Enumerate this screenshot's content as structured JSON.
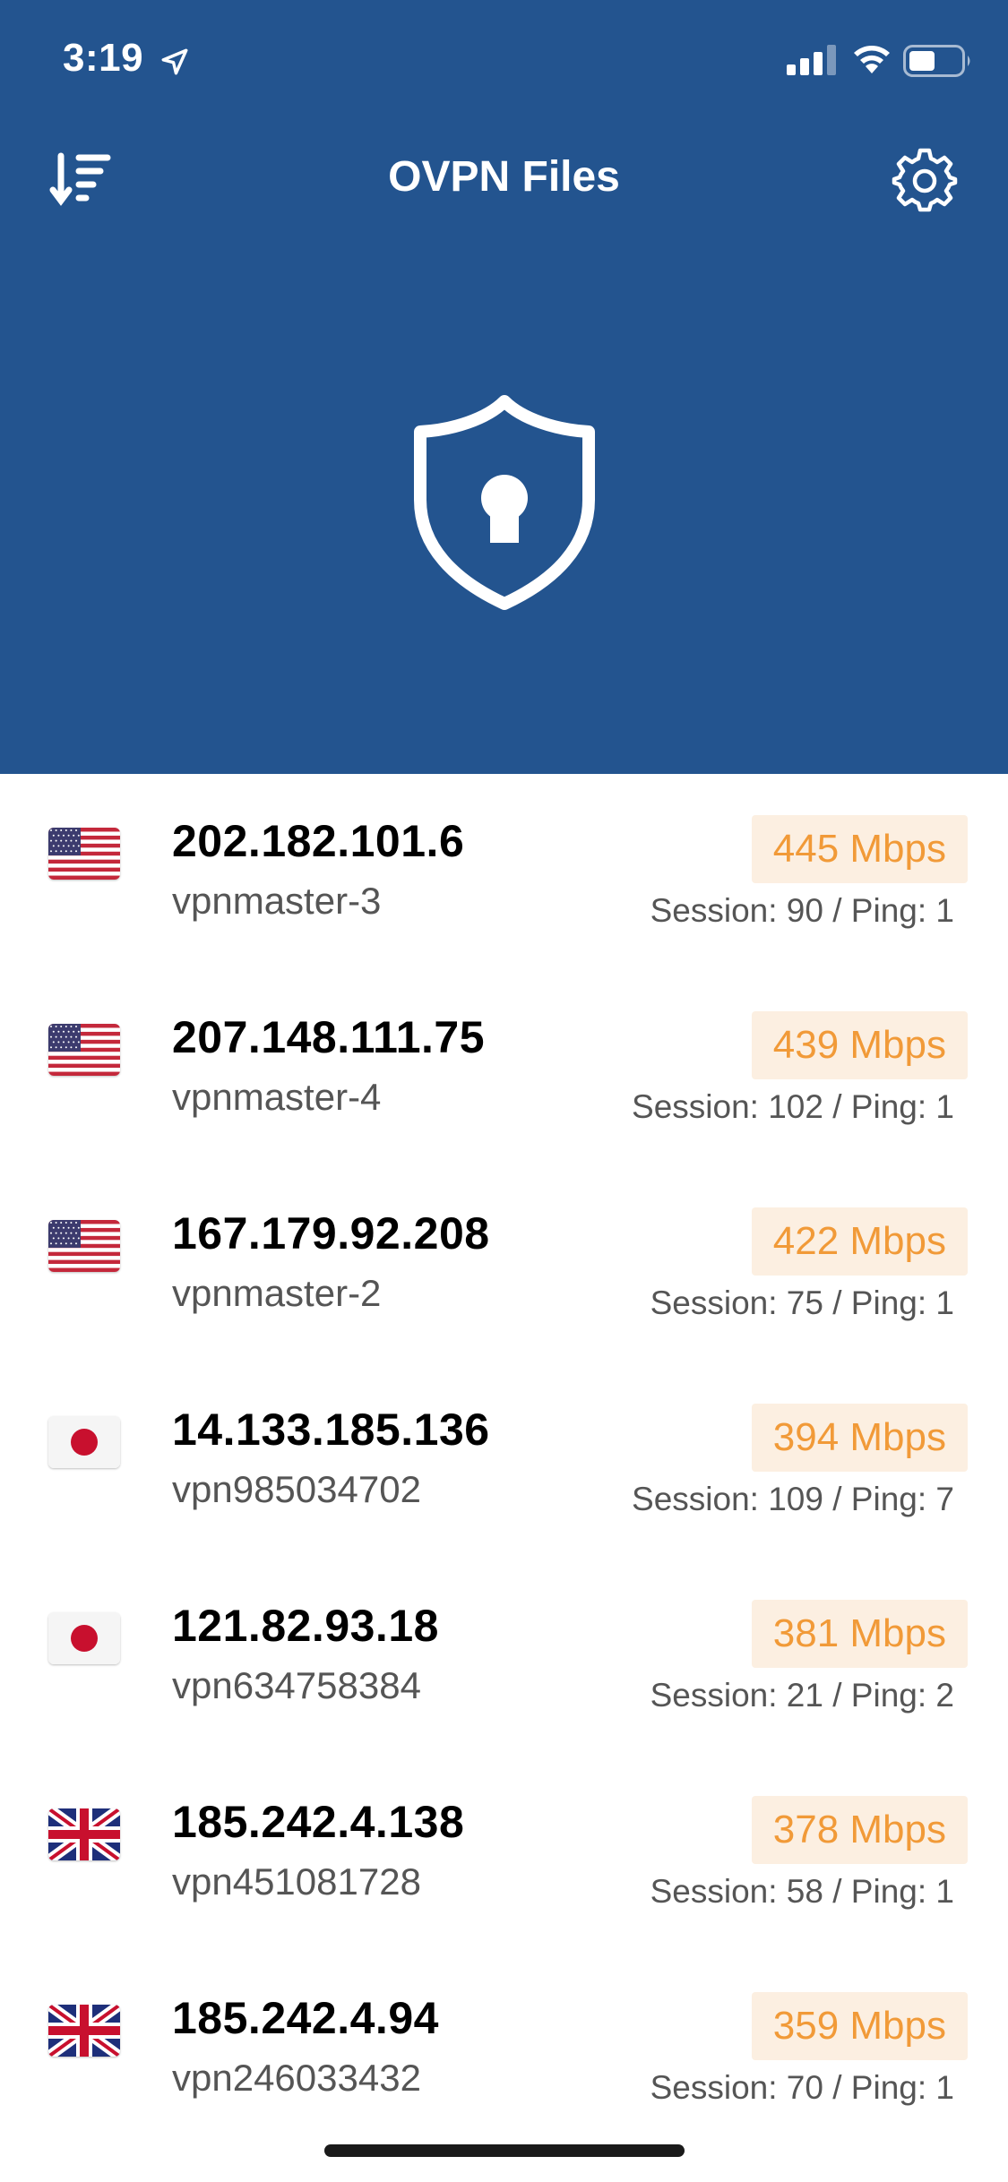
{
  "status_bar": {
    "time": "3:19"
  },
  "navbar": {
    "title": "OVPN Files",
    "left_icon": "sort-icon",
    "right_icon": "gear-icon"
  },
  "hero_icon": "shield-lock-icon",
  "colors": {
    "header_bg": "#23548F",
    "speed_text": "#F19A38",
    "speed_bg": "#FCEFE1"
  },
  "servers": [
    {
      "flag": "us",
      "ip": "202.182.101.6",
      "host": "vpnmaster-3",
      "speed": "445 Mbps",
      "session": "Session: 90 / Ping: 1"
    },
    {
      "flag": "us",
      "ip": "207.148.111.75",
      "host": "vpnmaster-4",
      "speed": "439 Mbps",
      "session": "Session: 102 / Ping: 1"
    },
    {
      "flag": "us",
      "ip": "167.179.92.208",
      "host": "vpnmaster-2",
      "speed": "422 Mbps",
      "session": "Session: 75 / Ping: 1"
    },
    {
      "flag": "jp",
      "ip": "14.133.185.136",
      "host": "vpn985034702",
      "speed": "394 Mbps",
      "session": "Session: 109 / Ping: 7"
    },
    {
      "flag": "jp",
      "ip": "121.82.93.18",
      "host": "vpn634758384",
      "speed": "381 Mbps",
      "session": "Session: 21 / Ping: 2"
    },
    {
      "flag": "gb",
      "ip": "185.242.4.138",
      "host": "vpn451081728",
      "speed": "378 Mbps",
      "session": "Session: 58 / Ping: 1"
    },
    {
      "flag": "gb",
      "ip": "185.242.4.94",
      "host": "vpn246033432",
      "speed": "359 Mbps",
      "session": "Session: 70 / Ping: 1"
    }
  ]
}
